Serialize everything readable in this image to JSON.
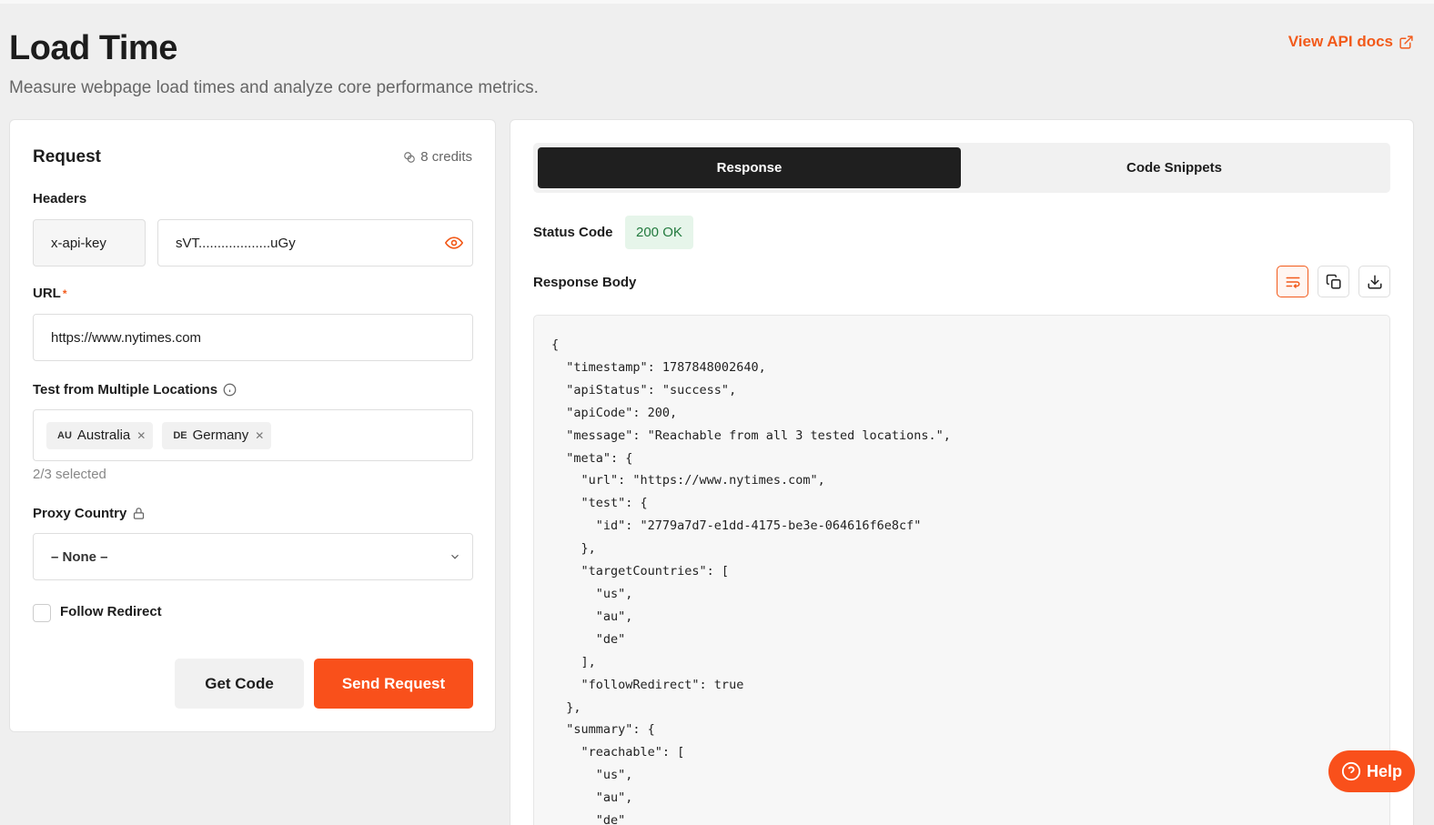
{
  "page": {
    "title": "Load Time",
    "subtitle": "Measure webpage load times and analyze core performance metrics.",
    "api_docs_label": "View API docs"
  },
  "request": {
    "title": "Request",
    "credits": "8 credits",
    "headers_label": "Headers",
    "header_key": "x-api-key",
    "header_value": "sVT...................uGy",
    "url_label": "URL",
    "url_required_mark": "*",
    "url_value": "https://www.nytimes.com",
    "locations_label": "Test from Multiple Locations",
    "locations": [
      {
        "code": "AU",
        "name": "Australia"
      },
      {
        "code": "DE",
        "name": "Germany"
      }
    ],
    "locations_selected": "2/3 selected",
    "proxy_label": "Proxy Country",
    "proxy_value": "– None –",
    "follow_redirect_label": "Follow Redirect",
    "follow_redirect_checked": false,
    "get_code_label": "Get Code",
    "send_label": "Send Request"
  },
  "response": {
    "tabs": [
      "Response",
      "Code Snippets"
    ],
    "active_tab": "Response",
    "status_label": "Status Code",
    "status_value": "200 OK",
    "body_label": "Response Body",
    "body_text": "{\n  \"timestamp\": 1787848002640,\n  \"apiStatus\": \"success\",\n  \"apiCode\": 200,\n  \"message\": \"Reachable from all 3 tested locations.\",\n  \"meta\": {\n    \"url\": \"https://www.nytimes.com\",\n    \"test\": {\n      \"id\": \"2779a7d7-e1dd-4175-be3e-064616f6e8cf\"\n    },\n    \"targetCountries\": [\n      \"us\",\n      \"au\",\n      \"de\"\n    ],\n    \"followRedirect\": true\n  },\n  \"summary\": {\n    \"reachable\": [\n      \"us\",\n      \"au\",\n      \"de\""
  },
  "help_label": "Help",
  "colors": {
    "accent": "#f9501b",
    "status_ok_bg": "#e6f5ea",
    "status_ok_text": "#227a3e"
  },
  "icons": [
    "external-link-icon",
    "credits-icon",
    "eye-icon",
    "info-icon",
    "lock-icon",
    "chevron-down-icon",
    "wrap-icon",
    "copy-icon",
    "download-icon",
    "help-icon"
  ]
}
